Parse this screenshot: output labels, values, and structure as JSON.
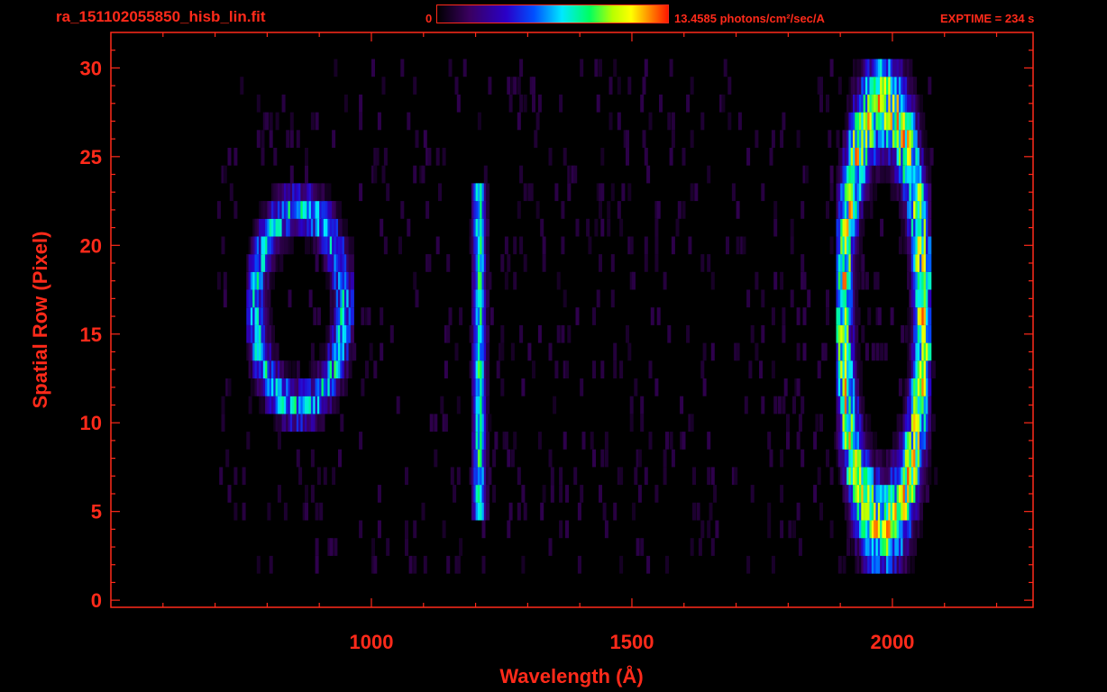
{
  "header": {
    "file_name": "ra_151102055850_hisb_lin.fit",
    "colorbar_min": "0",
    "colorbar_max": "13.4585 photons/cm²/sec/A",
    "exposure": "EXPTIME = 234 s"
  },
  "colors": {
    "axis": "#ff2a1a",
    "background": "#000000",
    "colormap": [
      "#000000",
      "#3a0060",
      "#2a00c8",
      "#0050ff",
      "#00e8ff",
      "#00ff60",
      "#b8ff00",
      "#ffff00",
      "#ff8a00",
      "#ff1800"
    ]
  },
  "chart_data": {
    "type": "heatmap",
    "title": "ra_151102055850_hisb_lin.fit",
    "xlabel": "Wavelength (Å)",
    "ylabel": "Spatial Row (Pixel)",
    "xlim": [
      500,
      2270
    ],
    "ylim": [
      -0.4,
      32
    ],
    "xticks": [
      1000,
      1500,
      2000
    ],
    "yticks": [
      0,
      5,
      10,
      15,
      20,
      25,
      30
    ],
    "value_range": [
      0,
      13.4585
    ],
    "value_unit": "photons/cm²/sec/A",
    "grid": false,
    "features": [
      {
        "label": "",
        "rows": [
          2,
          30
        ],
        "wavelength_range": [
          1890,
          2070
        ],
        "peak_wavelength": 2060,
        "peak_value": 13.0
      },
      {
        "label": "",
        "rows": [
          5,
          23
        ],
        "wavelength_range": [
          1190,
          1240
        ],
        "peak_wavelength": 1205,
        "peak_value": 8.5
      },
      {
        "label": "",
        "rows": [
          10,
          23
        ],
        "wavelength_range": [
          760,
          960
        ],
        "peak_wavelength": 880,
        "peak_value": 8.0
      }
    ]
  }
}
